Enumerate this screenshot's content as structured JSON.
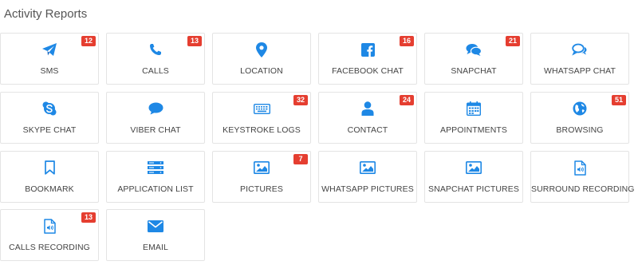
{
  "page": {
    "title": "Activity Reports"
  },
  "theme": {
    "icon_color": "#1e88e5",
    "badge_color": "#e53e30"
  },
  "tiles": [
    {
      "label": "SMS",
      "icon": "paper-plane-icon",
      "badge": "12"
    },
    {
      "label": "CALLS",
      "icon": "phone-icon",
      "badge": "13"
    },
    {
      "label": "LOCATION",
      "icon": "map-pin-icon",
      "badge": ""
    },
    {
      "label": "FACEBOOK CHAT",
      "icon": "facebook-icon",
      "badge": "16"
    },
    {
      "label": "SNAPCHAT",
      "icon": "chat-bubbles-icon",
      "badge": "21"
    },
    {
      "label": "WHATSAPP CHAT",
      "icon": "chat-bubbles-outline-icon",
      "badge": ""
    },
    {
      "label": "SKYPE CHAT",
      "icon": "skype-icon",
      "badge": ""
    },
    {
      "label": "VIBER CHAT",
      "icon": "speech-bubble-icon",
      "badge": ""
    },
    {
      "label": "KEYSTROKE LOGS",
      "icon": "keyboard-icon",
      "badge": "32"
    },
    {
      "label": "CONTACT",
      "icon": "user-icon",
      "badge": "24"
    },
    {
      "label": "APPOINTMENTS",
      "icon": "calendar-icon",
      "badge": ""
    },
    {
      "label": "BROWSING",
      "icon": "globe-icon",
      "badge": "51"
    },
    {
      "label": "BOOKMARK",
      "icon": "bookmark-icon",
      "badge": ""
    },
    {
      "label": "APPLICATION LIST",
      "icon": "server-list-icon",
      "badge": ""
    },
    {
      "label": "PICTURES",
      "icon": "picture-icon",
      "badge": "7"
    },
    {
      "label": "WHATSAPP PICTURES",
      "icon": "picture-icon",
      "badge": ""
    },
    {
      "label": "SNAPCHAT PICTURES",
      "icon": "picture-icon",
      "badge": ""
    },
    {
      "label": "SURROUND RECORDING",
      "icon": "audio-file-icon",
      "badge": ""
    },
    {
      "label": "CALLS RECORDING",
      "icon": "audio-file-icon",
      "badge": "13"
    },
    {
      "label": "EMAIL",
      "icon": "envelope-icon",
      "badge": ""
    }
  ]
}
